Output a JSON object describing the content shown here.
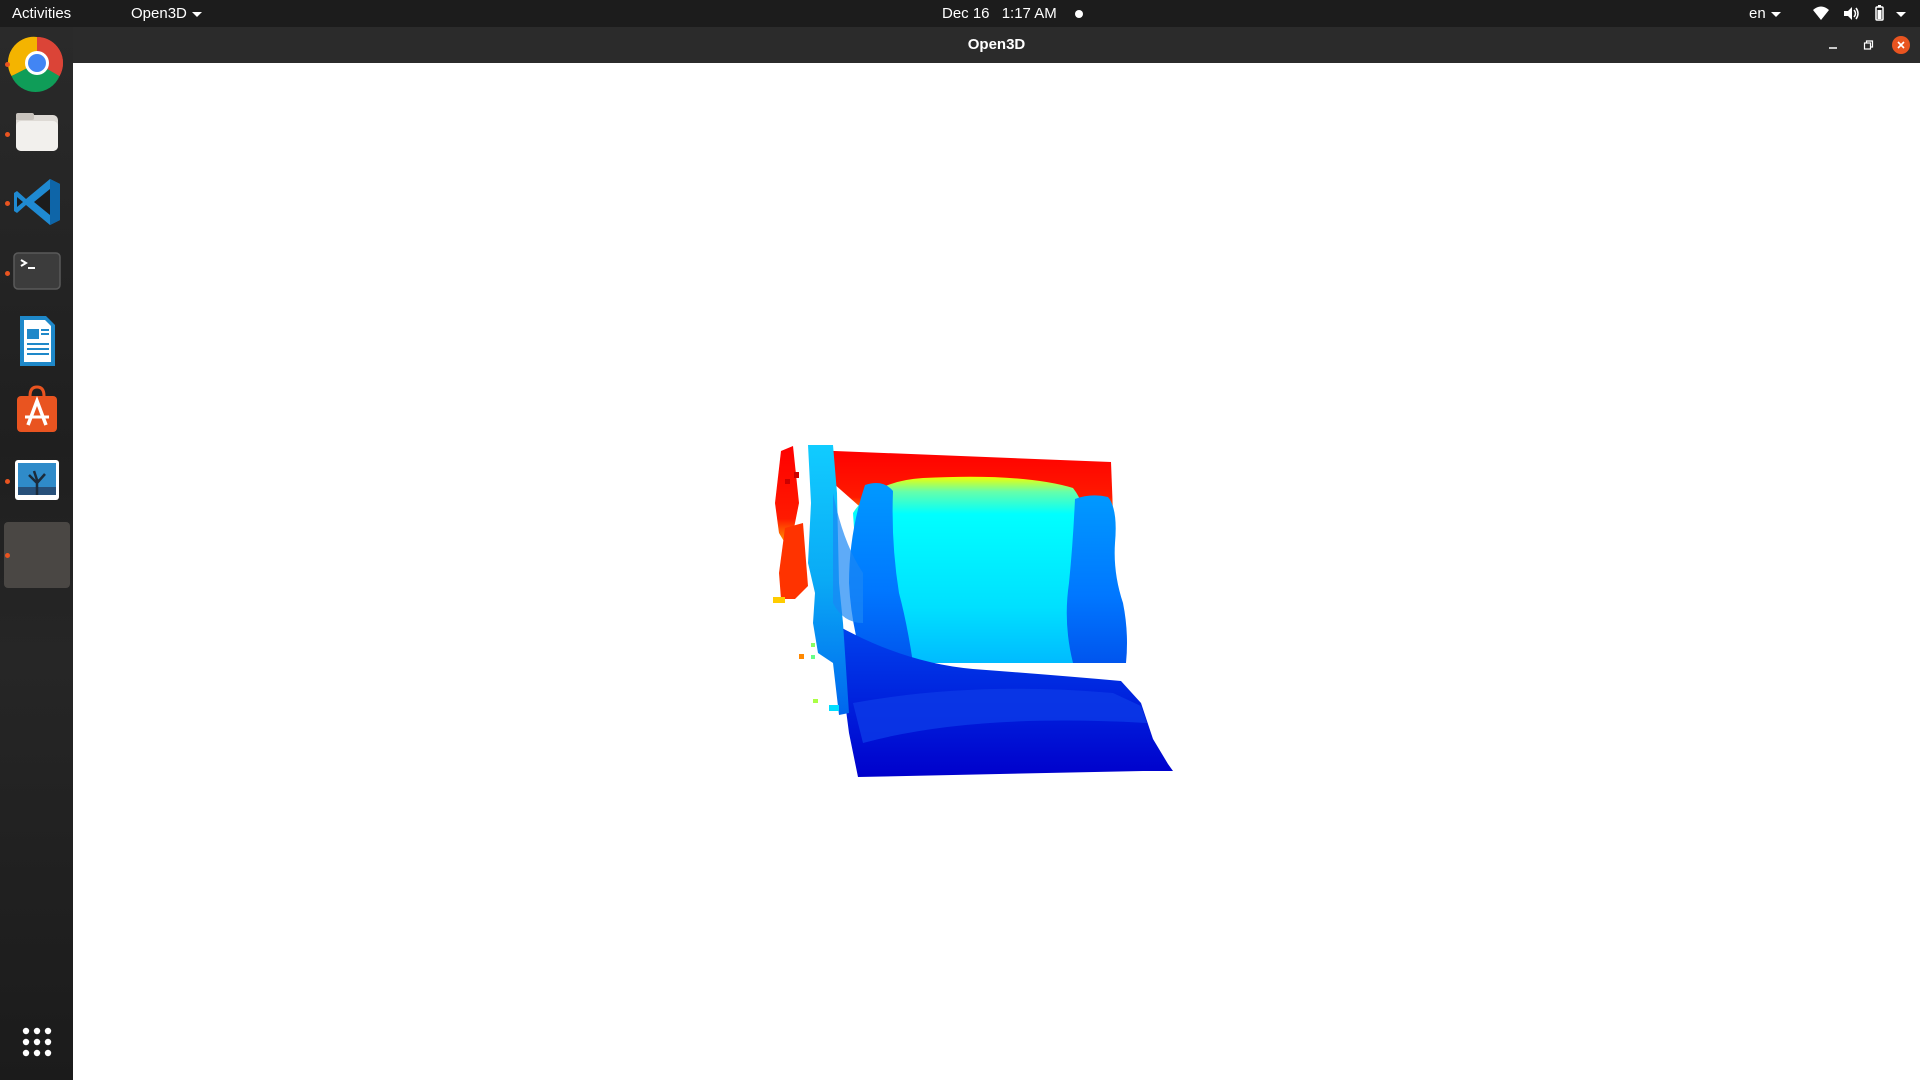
{
  "topbar": {
    "activities_label": "Activities",
    "app_menu_label": "Open3D",
    "date": "Dec 16",
    "time": "1:17 AM",
    "language": "en",
    "background_color": "#1c1c1c"
  },
  "dock": {
    "items": [
      {
        "name": "chrome-icon",
        "running": true
      },
      {
        "name": "files-icon",
        "running": true
      },
      {
        "name": "vscode-icon",
        "running": true
      },
      {
        "name": "terminal-icon",
        "running": true
      },
      {
        "name": "writer-icon",
        "running": false
      },
      {
        "name": "software-store-icon",
        "running": false
      },
      {
        "name": "image-viewer-icon",
        "running": true
      },
      {
        "name": "open3d-app-icon",
        "running": true,
        "active": true
      }
    ],
    "show_apps_icon": "grid-icon"
  },
  "window": {
    "title": "Open3D",
    "titlebar_color": "#2b2b2b",
    "close_button_color": "#e95420"
  },
  "viewer": {
    "background_color": "#ffffff",
    "content": "depth-colored-point-cloud",
    "colormap": [
      "#ff0000",
      "#ffff00",
      "#00ffff",
      "#0000ff"
    ]
  }
}
